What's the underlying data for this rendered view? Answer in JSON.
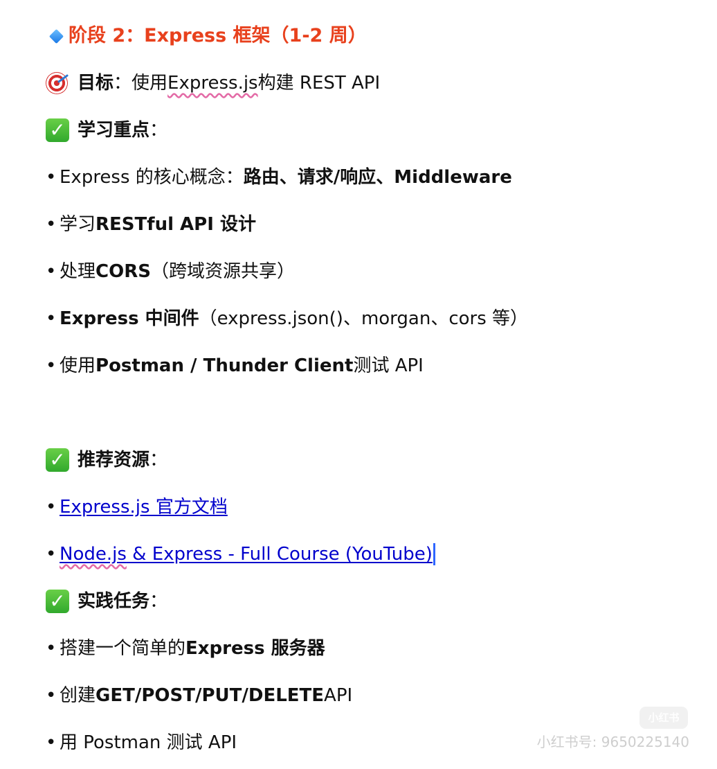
{
  "title": {
    "text": "阶段 2：Express 框架（1-2 周）"
  },
  "goal": {
    "label": "目标",
    "colon": "：",
    "text_before": "使用 ",
    "text_squiggle": "Express.js",
    "text_after": " 构建 REST API"
  },
  "sections": {
    "key_points": "学习重点",
    "resources": "推荐资源",
    "practice": "实践任务",
    "colon": "："
  },
  "key_points": {
    "items": [
      {
        "bullet": "•",
        "before": "Express 的核心概念：",
        "bold": "路由、请求/响应、Middleware",
        "after": ""
      },
      {
        "bullet": "•",
        "before": "学习 ",
        "bold": "RESTful API 设计",
        "after": ""
      },
      {
        "bullet": "•",
        "before": "处理 ",
        "bold": "CORS",
        "after": "（跨域资源共享）"
      },
      {
        "bullet": "•",
        "before": "",
        "bold": "Express 中间件",
        "after": "（express.json()、morgan、cors 等）"
      },
      {
        "bullet": "•",
        "before": "使用 ",
        "bold": "Postman / Thunder Client",
        "after": " 测试 API"
      }
    ]
  },
  "resources": {
    "items": [
      {
        "bullet": "•",
        "link_text": "Express.js 官方文档"
      },
      {
        "bullet": "•",
        "link_squiggle": "Node.js",
        "link_rest": " & Express - Full Course (YouTube)"
      }
    ]
  },
  "practice": {
    "items": [
      {
        "bullet": "•",
        "before": "搭建一个简单的 ",
        "bold": "Express 服务器",
        "after": ""
      },
      {
        "bullet": "•",
        "before": "创建 ",
        "bold": "GET/POST/PUT/DELETE",
        "after": " API"
      },
      {
        "bullet": "•",
        "before": "用 Postman 测试 API",
        "bold": "",
        "after": ""
      }
    ]
  },
  "watermark": {
    "badge": "小红书",
    "text": "小红书号: 9650225140"
  },
  "icons": {
    "title_icon": "blue-diamond-icon",
    "goal_icon": "target-icon",
    "section_icon": "check-mark-icon"
  },
  "colors": {
    "title": "#e8411d",
    "link": "#0000cc",
    "check": "#34ad2f",
    "diamond": "#1877e6",
    "target": "#d62f2f"
  }
}
